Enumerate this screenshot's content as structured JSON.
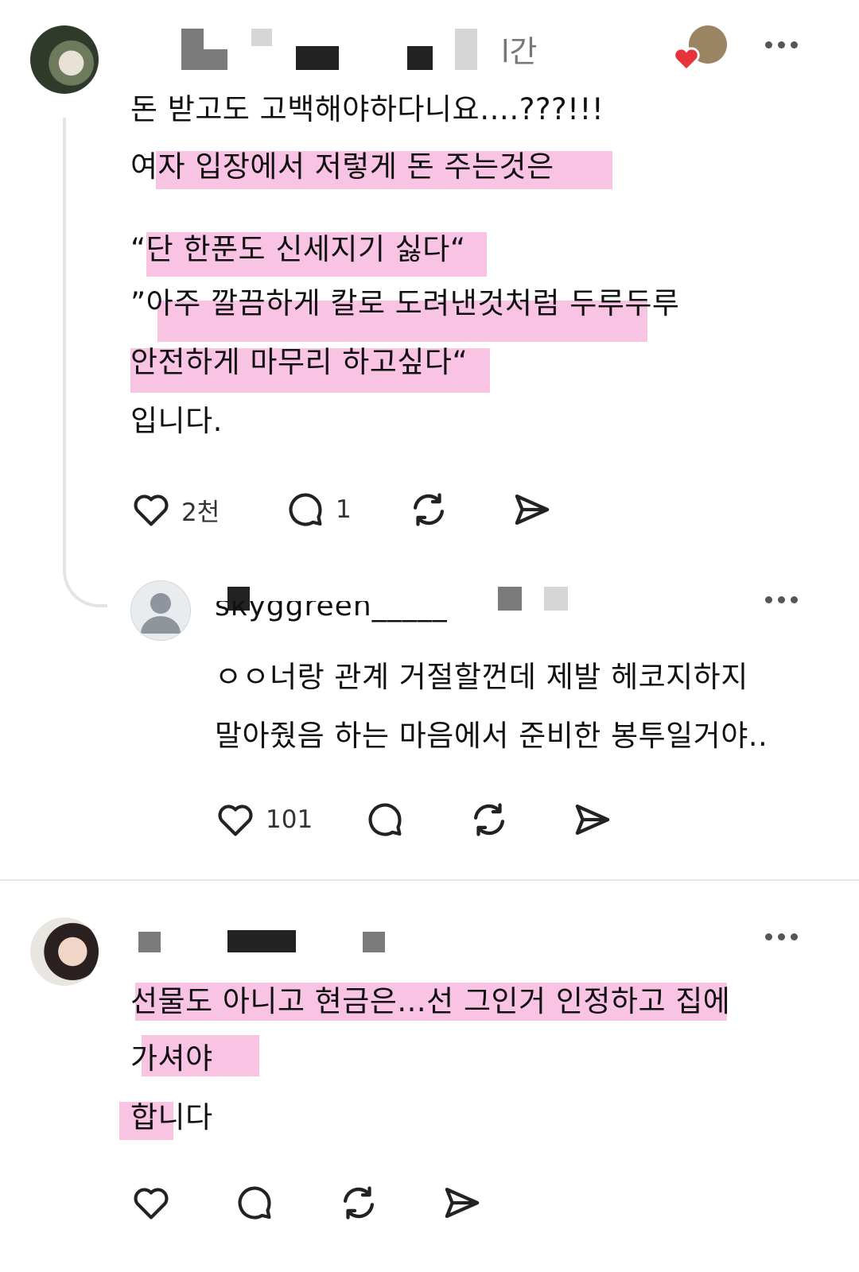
{
  "posts": [
    {
      "time_fragment": "l간",
      "body_lines": [
        "돈 받고도 고백해야하다니요….???!!!",
        "여자 입장에서 저렇게 돈 주는것은",
        "“단 한푼도 신세지기 싫다“",
        "”아주 깔끔하게 칼로 도려낸것처럼 두루두루",
        "안전하게 마무리 하고싶다“",
        "입니다."
      ],
      "like_count": "2천",
      "reply_count": "1"
    },
    {
      "username_fragment": "sкyggreen_____",
      "body_lines": [
        "ㅇㅇ너랑 관계 거절할껀데 제발 헤코지하지",
        "말아줬음 하는 마음에서 준비한 봉투일거야.."
      ],
      "like_count": "101"
    },
    {
      "body_lines": [
        "선물도 아니고 현금은...선 그인거 인정하고 집에",
        "가셔야",
        "합니다"
      ]
    }
  ],
  "colors": {
    "highlight": "#f9c3e4",
    "heart": "#e8323c"
  },
  "icons": [
    "heart-icon",
    "comment-icon",
    "repost-icon",
    "share-icon",
    "more-icon"
  ]
}
